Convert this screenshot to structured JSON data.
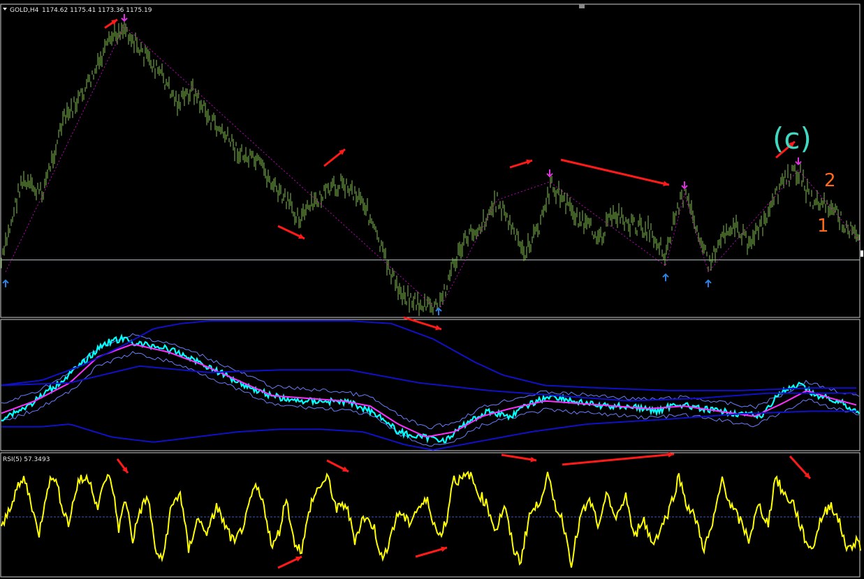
{
  "header": {
    "symbol": "GOLD,H4",
    "ohlc": "1174.62 1175.41 1173.36 1175.19"
  },
  "rsi_panel": {
    "label": "RSI(5) 57.3493"
  },
  "wave_labels": {
    "c": "(c)",
    "two": "2",
    "one": "1"
  },
  "colors": {
    "background": "#000000",
    "candles": "#7fbf4a",
    "zigzag": "#c000c0",
    "up_arrow": "#2f7fe0",
    "down_arrow": "#e030e0",
    "annotation_arrow": "#ff1a1a",
    "price_line": "#00ffff",
    "ma_line": "#ff30ff",
    "envelope": "#1010c8",
    "rsi_line": "#ffff00",
    "wave_c": "#40d8c0",
    "wave_numbers": "#ff6a1a"
  },
  "chart_data": [
    {
      "type": "candlestick",
      "pane": "main",
      "title": "GOLD,H4",
      "price_trend": [
        [
          0,
          0.85
        ],
        [
          30,
          0.56
        ],
        [
          60,
          0.6
        ],
        [
          90,
          0.36
        ],
        [
          115,
          0.28
        ],
        [
          135,
          0.2
        ],
        [
          160,
          0.08
        ],
        [
          178,
          0.04
        ],
        [
          200,
          0.12
        ],
        [
          230,
          0.2
        ],
        [
          255,
          0.3
        ],
        [
          275,
          0.25
        ],
        [
          300,
          0.35
        ],
        [
          320,
          0.4
        ],
        [
          345,
          0.47
        ],
        [
          370,
          0.5
        ],
        [
          400,
          0.6
        ],
        [
          430,
          0.68
        ],
        [
          455,
          0.62
        ],
        [
          490,
          0.56
        ],
        [
          520,
          0.62
        ],
        [
          545,
          0.78
        ],
        [
          570,
          0.92
        ],
        [
          600,
          0.97
        ],
        [
          628,
          0.98
        ],
        [
          648,
          0.84
        ],
        [
          670,
          0.74
        ],
        [
          690,
          0.7
        ],
        [
          712,
          0.62
        ],
        [
          730,
          0.7
        ],
        [
          750,
          0.8
        ],
        [
          770,
          0.72
        ],
        [
          790,
          0.57
        ],
        [
          810,
          0.63
        ],
        [
          835,
          0.7
        ],
        [
          860,
          0.74
        ],
        [
          880,
          0.66
        ],
        [
          900,
          0.7
        ],
        [
          930,
          0.72
        ],
        [
          953,
          0.8
        ],
        [
          968,
          0.66
        ],
        [
          980,
          0.6
        ],
        [
          1000,
          0.72
        ],
        [
          1015,
          0.84
        ],
        [
          1035,
          0.73
        ],
        [
          1050,
          0.7
        ],
        [
          1070,
          0.76
        ],
        [
          1095,
          0.7
        ],
        [
          1120,
          0.56
        ],
        [
          1143,
          0.52
        ],
        [
          1160,
          0.62
        ],
        [
          1185,
          0.64
        ],
        [
          1210,
          0.7
        ],
        [
          1232,
          0.76
        ]
      ],
      "zigzag_turning_points": [
        [
          8,
          0.86
        ],
        [
          178,
          0.04
        ],
        [
          628,
          0.99
        ],
        [
          712,
          0.62
        ],
        [
          787,
          0.56
        ],
        [
          953,
          0.84
        ],
        [
          980,
          0.6
        ],
        [
          1014,
          0.86
        ],
        [
          1143,
          0.52
        ],
        [
          1232,
          0.76
        ]
      ],
      "up_arrows_at": [
        8,
        628,
        953,
        1014
      ],
      "down_arrows_at": [
        178,
        787,
        980,
        1143
      ],
      "horizontal_line_level": 0.82
    },
    {
      "type": "line",
      "pane": "bands",
      "series": [
        {
          "values": [
            [
              0,
              0.76
            ],
            [
              40,
              0.66
            ],
            [
              80,
              0.5
            ],
            [
              120,
              0.32
            ],
            [
              150,
              0.17
            ],
            [
              175,
              0.14
            ],
            [
              200,
              0.18
            ],
            [
              230,
              0.2
            ],
            [
              270,
              0.28
            ],
            [
              300,
              0.36
            ],
            [
              330,
              0.44
            ],
            [
              360,
              0.52
            ],
            [
              390,
              0.58
            ],
            [
              420,
              0.62
            ],
            [
              460,
              0.62
            ],
            [
              500,
              0.63
            ],
            [
              540,
              0.72
            ],
            [
              570,
              0.86
            ],
            [
              600,
              0.9
            ],
            [
              640,
              0.92
            ],
            [
              670,
              0.78
            ],
            [
              700,
              0.7
            ],
            [
              730,
              0.74
            ],
            [
              760,
              0.64
            ],
            [
              790,
              0.58
            ],
            [
              820,
              0.62
            ],
            [
              860,
              0.66
            ],
            [
              900,
              0.66
            ],
            [
              940,
              0.7
            ],
            [
              970,
              0.64
            ],
            [
              1000,
              0.68
            ],
            [
              1030,
              0.7
            ],
            [
              1060,
              0.72
            ],
            [
              1090,
              0.74
            ],
            [
              1115,
              0.56
            ],
            [
              1145,
              0.5
            ],
            [
              1170,
              0.58
            ],
            [
              1200,
              0.62
            ],
            [
              1232,
              0.72
            ]
          ]
        },
        {
          "values": [
            [
              0,
              0.72
            ],
            [
              50,
              0.62
            ],
            [
              100,
              0.48
            ],
            [
              140,
              0.28
            ],
            [
              190,
              0.18
            ],
            [
              240,
              0.24
            ],
            [
              290,
              0.34
            ],
            [
              340,
              0.46
            ],
            [
              390,
              0.58
            ],
            [
              440,
              0.6
            ],
            [
              490,
              0.62
            ],
            [
              530,
              0.66
            ],
            [
              570,
              0.8
            ],
            [
              610,
              0.9
            ],
            [
              650,
              0.86
            ],
            [
              690,
              0.74
            ],
            [
              730,
              0.68
            ],
            [
              780,
              0.62
            ],
            [
              830,
              0.64
            ],
            [
              880,
              0.66
            ],
            [
              930,
              0.68
            ],
            [
              980,
              0.66
            ],
            [
              1030,
              0.7
            ],
            [
              1080,
              0.74
            ],
            [
              1120,
              0.64
            ],
            [
              1155,
              0.54
            ],
            [
              1190,
              0.6
            ],
            [
              1232,
              0.66
            ]
          ]
        },
        {
          "values": [
            [
              0,
              0.5
            ],
            [
              100,
              0.48
            ],
            [
              200,
              0.35
            ],
            [
              300,
              0.4
            ],
            [
              400,
              0.38
            ],
            [
              500,
              0.38
            ],
            [
              600,
              0.48
            ],
            [
              700,
              0.54
            ],
            [
              800,
              0.58
            ],
            [
              900,
              0.62
            ],
            [
              1000,
              0.6
            ],
            [
              1100,
              0.56
            ],
            [
              1232,
              0.56
            ]
          ]
        },
        {
          "values": [
            [
              0,
              0.5
            ],
            [
              60,
              0.46
            ],
            [
              120,
              0.34
            ],
            [
              180,
              0.18
            ],
            [
              220,
              0.06
            ],
            [
              260,
              0.02
            ],
            [
              300,
              0
            ],
            [
              400,
              0
            ],
            [
              500,
              0
            ],
            [
              560,
              0.02
            ],
            [
              620,
              0.14
            ],
            [
              680,
              0.32
            ],
            [
              720,
              0.42
            ],
            [
              780,
              0.5
            ],
            [
              860,
              0.52
            ],
            [
              960,
              0.54
            ],
            [
              1060,
              0.54
            ],
            [
              1160,
              0.52
            ],
            [
              1232,
              0.52
            ]
          ]
        },
        {
          "values": [
            [
              0,
              0.82
            ],
            [
              60,
              0.82
            ],
            [
              100,
              0.8
            ],
            [
              160,
              0.9
            ],
            [
              220,
              0.94
            ],
            [
              280,
              0.9
            ],
            [
              340,
              0.86
            ],
            [
              400,
              0.84
            ],
            [
              460,
              0.84
            ],
            [
              520,
              0.86
            ],
            [
              580,
              0.96
            ],
            [
              620,
              1
            ],
            [
              680,
              0.94
            ],
            [
              760,
              0.86
            ],
            [
              840,
              0.8
            ],
            [
              960,
              0.76
            ],
            [
              1060,
              0.72
            ],
            [
              1160,
              0.7
            ],
            [
              1232,
              0.7
            ]
          ]
        }
      ]
    },
    {
      "type": "line",
      "pane": "rsi",
      "title": "RSI(5) 57.3493",
      "ylim": [
        0,
        100
      ],
      "series": [
        {
          "values": [
            [
              0,
              35
            ],
            [
              12,
              55
            ],
            [
              22,
              72
            ],
            [
              35,
              84
            ],
            [
              48,
              55
            ],
            [
              55,
              32
            ],
            [
              68,
              78
            ],
            [
              78,
              86
            ],
            [
              88,
              62
            ],
            [
              98,
              44
            ],
            [
              112,
              82
            ],
            [
              128,
              84
            ],
            [
              140,
              58
            ],
            [
              152,
              86
            ],
            [
              160,
              80
            ],
            [
              170,
              40
            ],
            [
              180,
              66
            ],
            [
              190,
              30
            ],
            [
              200,
              55
            ],
            [
              212,
              68
            ],
            [
              222,
              22
            ],
            [
              232,
              10
            ],
            [
              245,
              58
            ],
            [
              258,
              72
            ],
            [
              270,
              20
            ],
            [
              282,
              48
            ],
            [
              298,
              36
            ],
            [
              310,
              60
            ],
            [
              322,
              42
            ],
            [
              336,
              26
            ],
            [
              352,
              48
            ],
            [
              365,
              78
            ],
            [
              378,
              60
            ],
            [
              390,
              22
            ],
            [
              400,
              38
            ],
            [
              410,
              68
            ],
            [
              420,
              30
            ],
            [
              432,
              20
            ],
            [
              445,
              62
            ],
            [
              458,
              78
            ],
            [
              470,
              84
            ],
            [
              482,
              56
            ],
            [
              495,
              62
            ],
            [
              508,
              30
            ],
            [
              520,
              50
            ],
            [
              535,
              42
            ],
            [
              548,
              10
            ],
            [
              560,
              36
            ],
            [
              572,
              55
            ],
            [
              585,
              44
            ],
            [
              598,
              58
            ],
            [
              612,
              64
            ],
            [
              628,
              32
            ],
            [
              640,
              48
            ],
            [
              648,
              84
            ],
            [
              660,
              82
            ],
            [
              672,
              88
            ],
            [
              684,
              72
            ],
            [
              696,
              62
            ],
            [
              710,
              38
            ],
            [
              722,
              60
            ],
            [
              735,
              22
            ],
            [
              745,
              10
            ],
            [
              758,
              52
            ],
            [
              770,
              60
            ],
            [
              784,
              86
            ],
            [
              794,
              62
            ],
            [
              806,
              46
            ],
            [
              818,
              10
            ],
            [
              832,
              52
            ],
            [
              845,
              64
            ],
            [
              858,
              40
            ],
            [
              870,
              72
            ],
            [
              882,
              46
            ],
            [
              896,
              70
            ],
            [
              908,
              30
            ],
            [
              920,
              50
            ],
            [
              934,
              26
            ],
            [
              946,
              40
            ],
            [
              958,
              56
            ],
            [
              972,
              86
            ],
            [
              984,
              60
            ],
            [
              996,
              48
            ],
            [
              1008,
              22
            ],
            [
              1020,
              42
            ],
            [
              1034,
              84
            ],
            [
              1046,
              60
            ],
            [
              1060,
              46
            ],
            [
              1072,
              30
            ],
            [
              1086,
              60
            ],
            [
              1100,
              44
            ],
            [
              1110,
              86
            ],
            [
              1122,
              70
            ],
            [
              1136,
              62
            ],
            [
              1150,
              34
            ],
            [
              1162,
              20
            ],
            [
              1175,
              48
            ],
            [
              1190,
              62
            ],
            [
              1202,
              44
            ],
            [
              1214,
              20
            ],
            [
              1226,
              30
            ],
            [
              1232,
              24
            ]
          ]
        }
      ],
      "midline_level": 50
    }
  ]
}
